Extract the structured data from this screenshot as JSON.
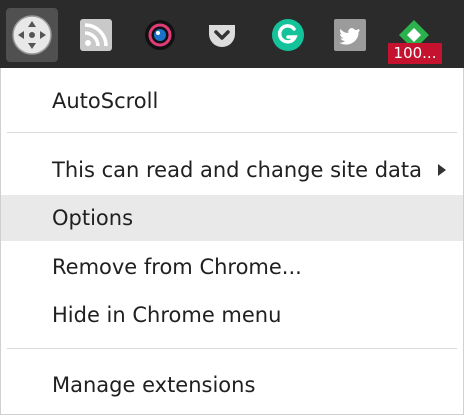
{
  "toolbar": {
    "icons": [
      {
        "name": "autoscroll-icon"
      },
      {
        "name": "rss-icon"
      },
      {
        "name": "camera-lens-icon"
      },
      {
        "name": "pocket-icon"
      },
      {
        "name": "grammarly-icon"
      },
      {
        "name": "twitter-icon"
      },
      {
        "name": "feedly-icon"
      }
    ],
    "badge": "100..."
  },
  "menu": {
    "title": "AutoScroll",
    "site_data": "This can read and change site data",
    "options": "Options",
    "remove": "Remove from Chrome...",
    "hide": "Hide in Chrome menu",
    "manage": "Manage extensions"
  },
  "colors": {
    "toolbar_bg": "#2b2b2b",
    "badge_bg": "#c4122f",
    "hover_bg": "#e9e9e9",
    "grammarly": "#15c39a",
    "feedly": "#2bb24c"
  }
}
